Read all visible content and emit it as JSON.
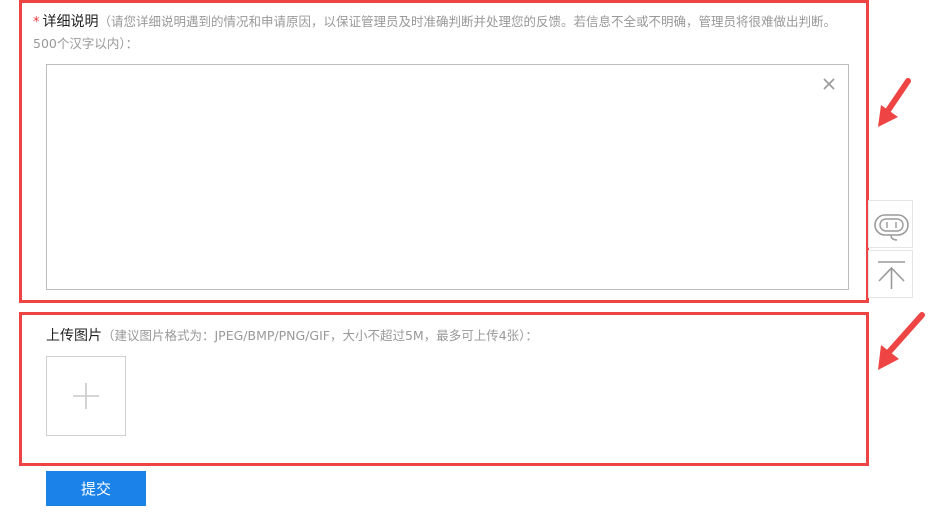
{
  "detail": {
    "required_mark": "*",
    "label": "详细说明",
    "hint": "（请您详细说明遇到的情况和申请原因，以保证管理员及时准确判断并处理您的反馈。若信息不全或不明确，管理员将很难做出判断。500个汉字以内）：",
    "value": "",
    "clear_icon": "close-icon"
  },
  "upload": {
    "label": "上传图片",
    "hint": "（建议图片格式为：JPEG/BMP/PNG/GIF，大小不超过5M，最多可上传4张）：",
    "add_icon": "plus-icon"
  },
  "submit": {
    "label": "提交"
  },
  "float_panel": {
    "service_icon": "customer-service-icon",
    "top_icon": "back-to-top-icon"
  },
  "colors": {
    "highlight": "#ef4444",
    "primary": "#1a82e8",
    "required": "#e53935"
  }
}
